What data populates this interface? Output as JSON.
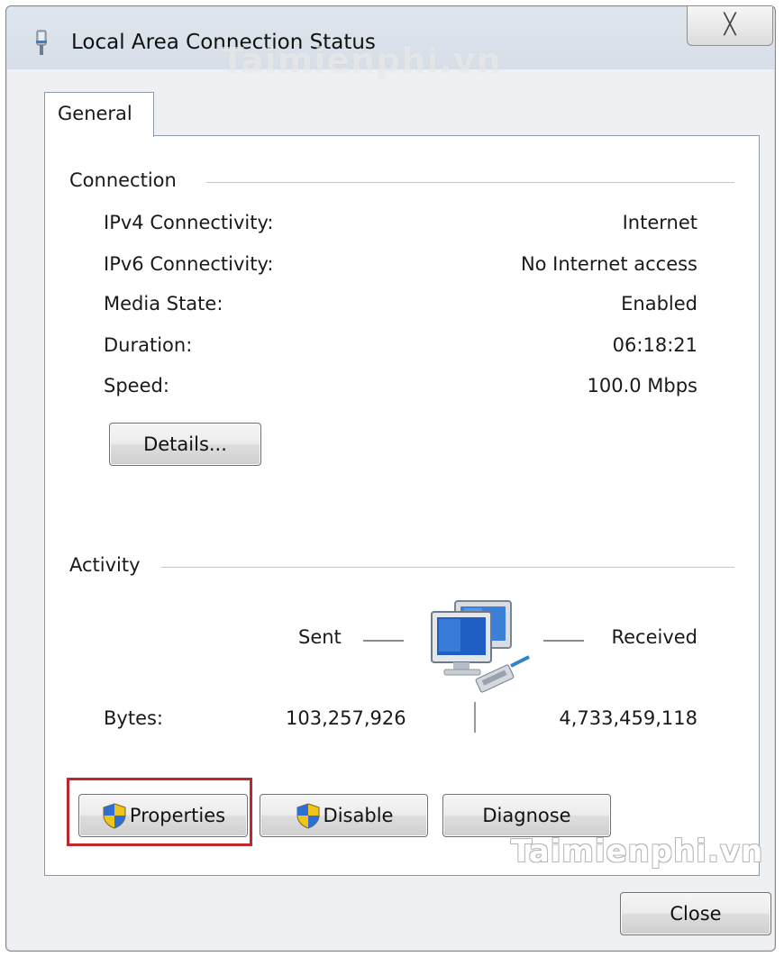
{
  "window": {
    "title": "Local Area Connection Status",
    "close_glyph": "╳"
  },
  "watermark": {
    "top": "Taimienphi.vn",
    "bottom": "Taimienphi.vn"
  },
  "tabs": [
    {
      "label": "General"
    }
  ],
  "connection": {
    "title": "Connection",
    "rows": [
      {
        "label": "IPv4 Connectivity:",
        "value": "Internet"
      },
      {
        "label": "IPv6 Connectivity:",
        "value": "No Internet access"
      },
      {
        "label": "Media State:",
        "value": "Enabled"
      },
      {
        "label": "Duration:",
        "value": "06:18:21"
      },
      {
        "label": "Speed:",
        "value": "100.0 Mbps"
      }
    ],
    "details_button": "Details..."
  },
  "activity": {
    "title": "Activity",
    "sent_label": "Sent",
    "received_label": "Received",
    "bytes_label": "Bytes:",
    "bytes_sent": "103,257,926",
    "bytes_received": "4,733,459,118"
  },
  "buttons": {
    "properties": "Properties",
    "disable": "Disable",
    "diagnose": "Diagnose",
    "close": "Close"
  },
  "icons": {
    "titlebar": "network-adapter-icon",
    "activity": "network-computers-icon",
    "uac": "uac-shield-icon"
  },
  "colors": {
    "highlight_box": "#c0272d",
    "panel_border": "#8d9aa8"
  }
}
